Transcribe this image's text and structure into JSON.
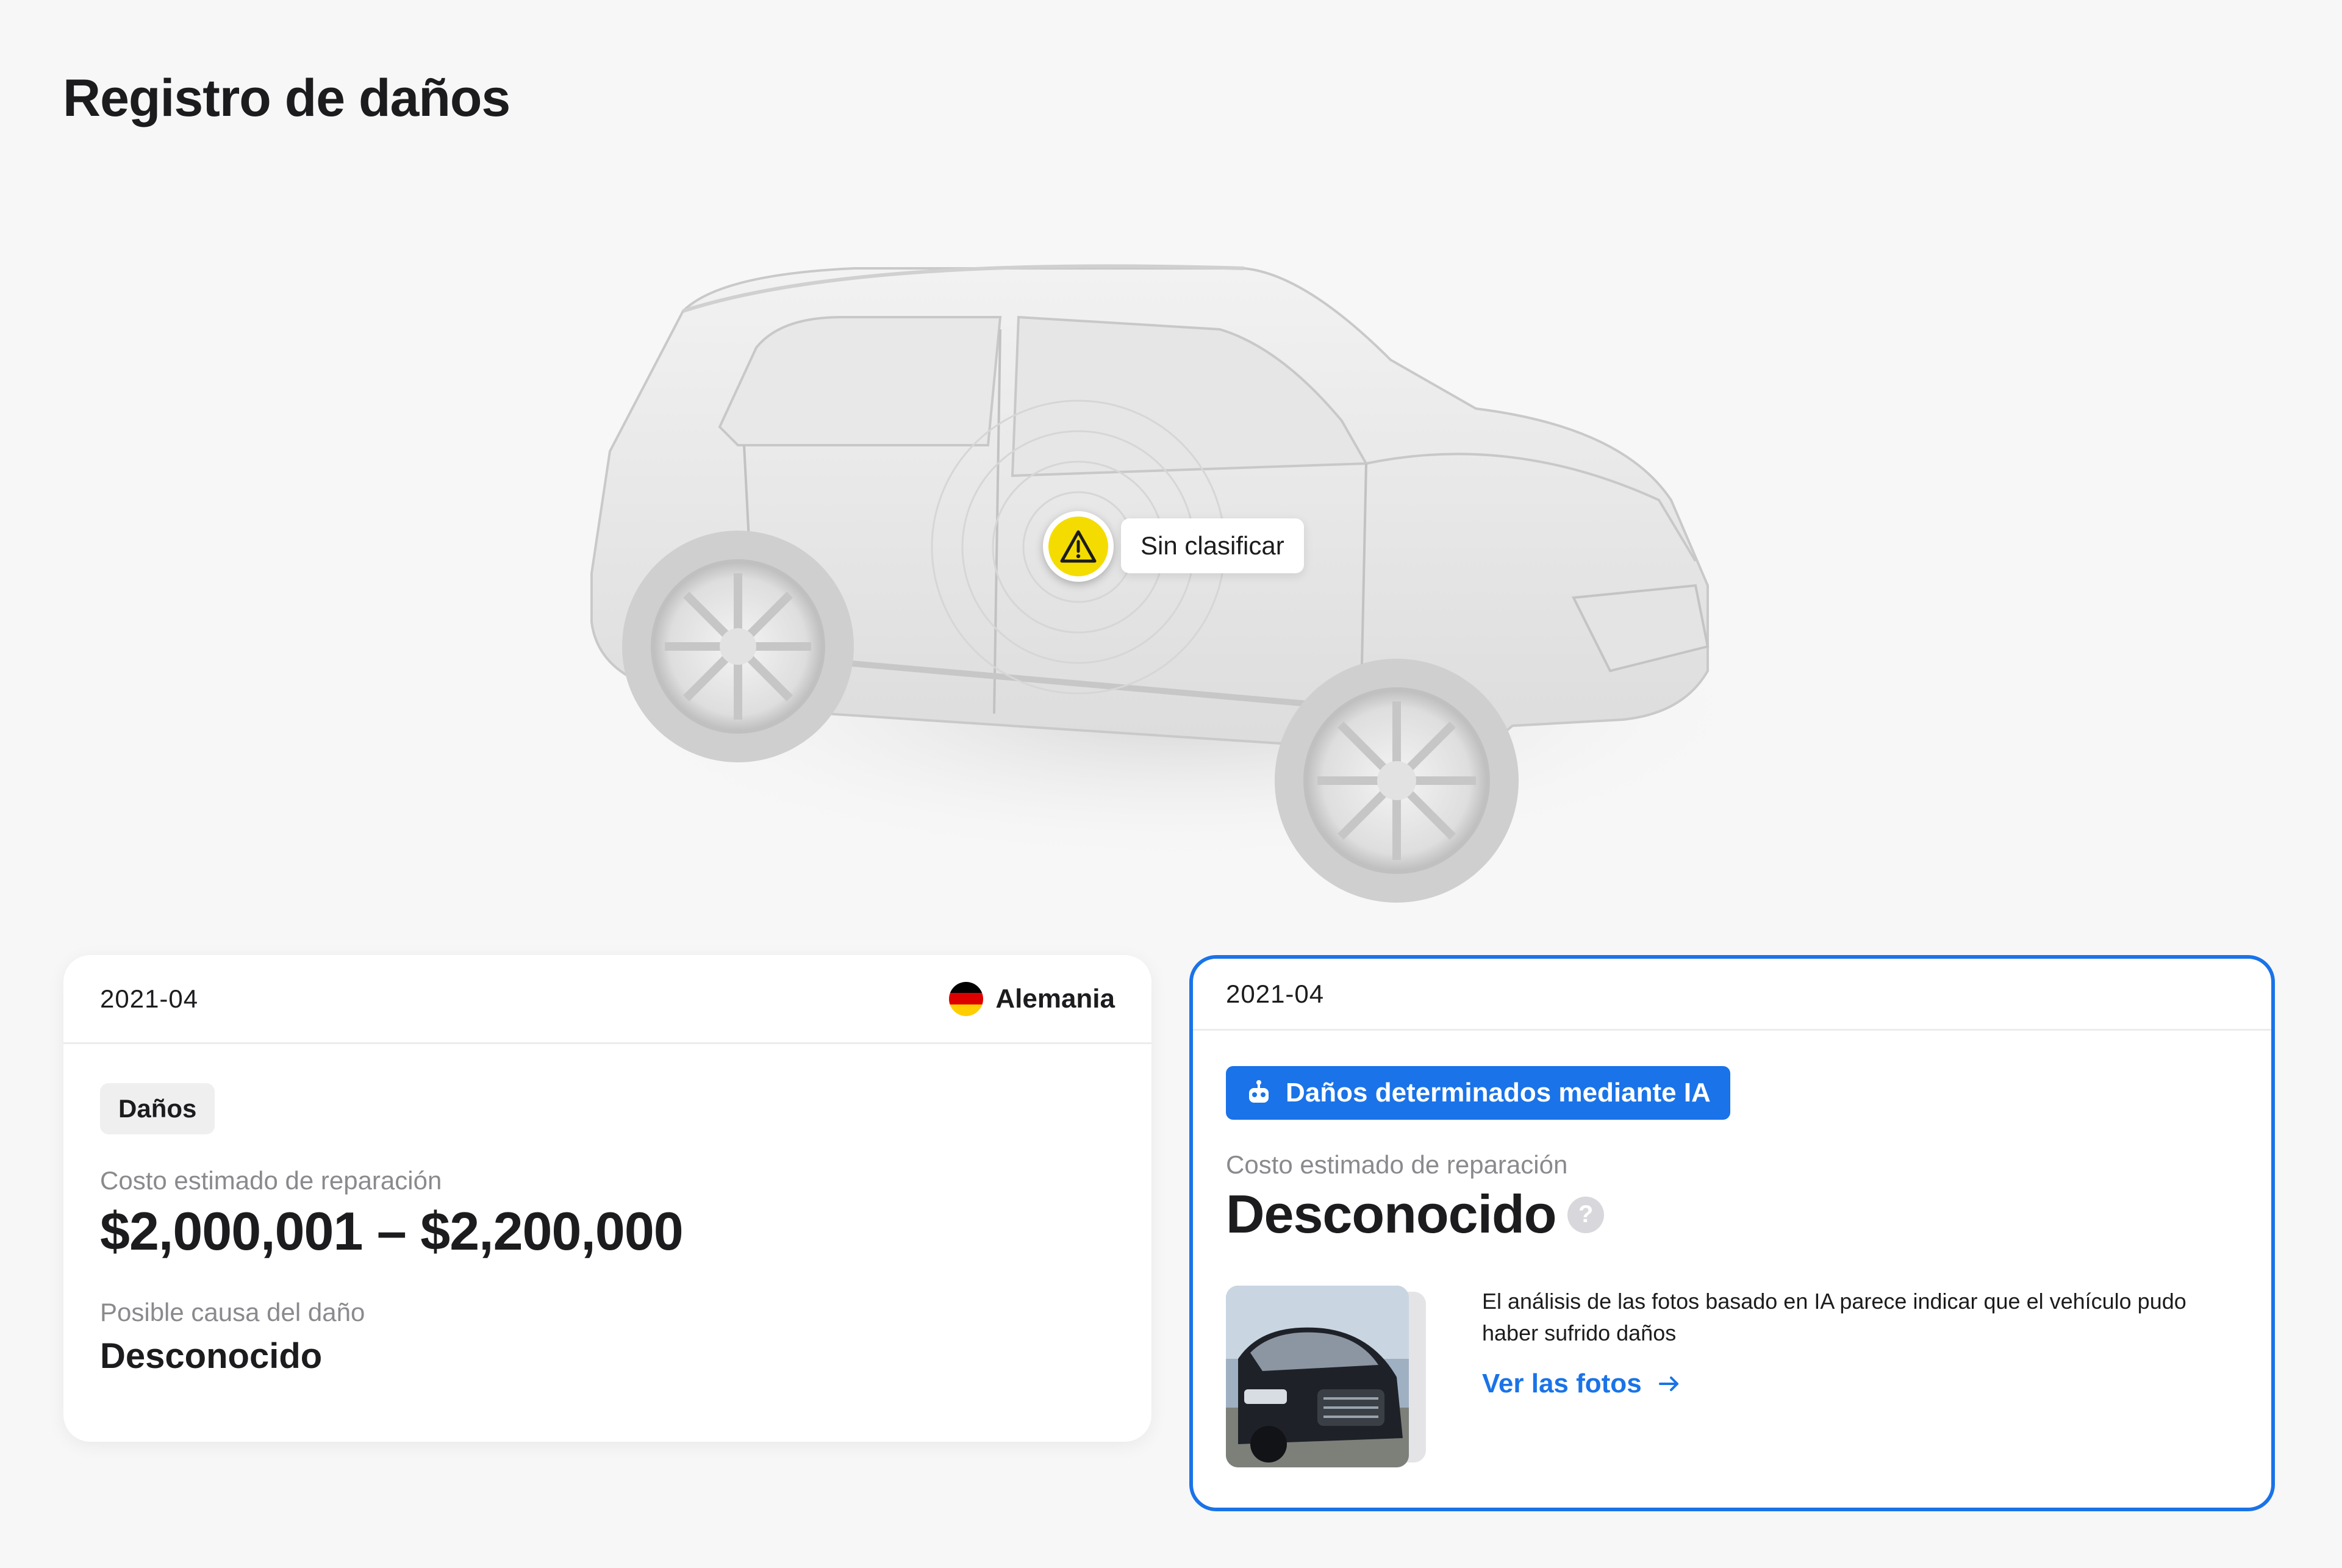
{
  "page": {
    "title": "Registro de daños"
  },
  "vehicle_view": {
    "marker_label": "Sin clasificar",
    "marker_color": "#f4dc00"
  },
  "records": [
    {
      "date": "2021-04",
      "country": "Alemania",
      "country_flag": "germany-flag-icon",
      "tag": "Daños",
      "repair_cost_label": "Costo estimado de reparación",
      "repair_cost": "$2,000,001 – $2,200,000",
      "cause_label": "Posible causa del daño",
      "cause": "Desconocido"
    },
    {
      "date": "2021-04",
      "badge": "Daños determinados mediante IA",
      "badge_icon": "robot-icon",
      "repair_cost_label": "Costo estimado de reparación",
      "repair_cost": "Desconocido",
      "help_icon": "?",
      "photo_description": "El análisis de las fotos basado en IA parece indicar que el vehículo pudo haber sufrido daños",
      "photo_link": "Ver las fotos"
    }
  ],
  "colors": {
    "accent": "#1a73e8",
    "background": "#f7f7f7",
    "warning": "#f4dc00"
  }
}
